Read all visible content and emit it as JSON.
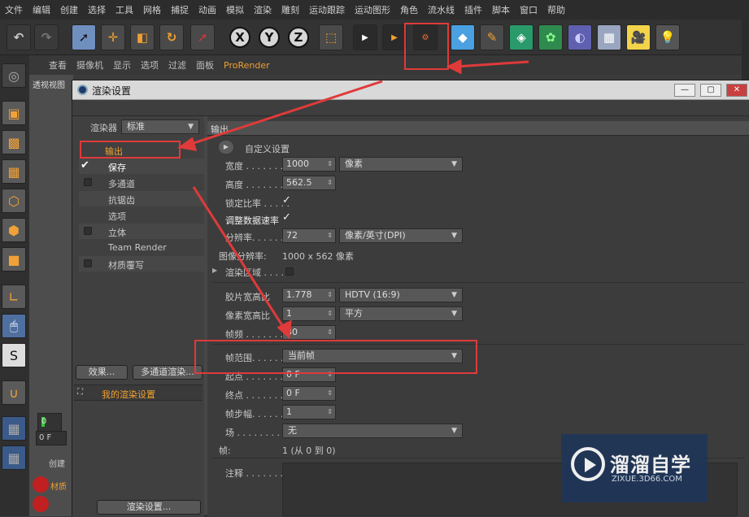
{
  "menubar": {
    "items": [
      "文件",
      "编辑",
      "创建",
      "选择",
      "工具",
      "网格",
      "捕捉",
      "动画",
      "模拟",
      "渲染",
      "雕刻",
      "运动跟踪",
      "运动图形",
      "角色",
      "流水线",
      "插件",
      "脚本",
      "窗口",
      "帮助"
    ]
  },
  "toolbar": {
    "icons": [
      "undo-icon",
      "redo-icon",
      "live-select-icon",
      "move-icon",
      "scale-icon",
      "rotate-icon",
      "recent-tool-icon",
      "x-axis-icon",
      "y-axis-icon",
      "z-axis-icon",
      "coordinate-system-icon",
      "render-view-icon",
      "render-picture-viewer-icon",
      "edit-render-settings-icon",
      "cube-icon",
      "pen-icon",
      "subdivision-icon",
      "cloner-icon",
      "deformer-icon",
      "floor-icon",
      "camera-icon",
      "light-icon"
    ],
    "axis_labels": [
      "X",
      "Y",
      "Z"
    ]
  },
  "viewport_menu": [
    "查看",
    "摄像机",
    "显示",
    "选项",
    "过滤",
    "面板",
    "ProRender"
  ],
  "viewport": {
    "title": "透视视图"
  },
  "dialog": {
    "title": "渲染设置",
    "renderer_label": "渲染器",
    "renderer_value": "标准",
    "section_header": "输出",
    "nav_items": [
      {
        "label": "输出",
        "has_check": false,
        "checked": false
      },
      {
        "label": "保存",
        "has_check": true,
        "checked": true
      },
      {
        "label": "多通道",
        "has_check": true,
        "checked": false
      },
      {
        "label": "抗锯齿",
        "has_check": false,
        "checked": false
      },
      {
        "label": "选项",
        "has_check": false,
        "checked": false
      },
      {
        "label": "立体",
        "has_check": true,
        "checked": false
      },
      {
        "label": "Team Render",
        "has_check": false,
        "checked": false
      },
      {
        "label": "材质覆写",
        "has_check": true,
        "checked": false
      }
    ],
    "effects_button": "效果...",
    "multipass_button": "多通道渲染...",
    "my_render_setting": "我的渲染设置",
    "render_settings_button": "渲染设置...",
    "custom_settings": "自定义设置",
    "width_label": "宽度 . . . . . . . .",
    "width_value": "1000",
    "width_unit": "像素",
    "height_label": "高度 . . . . . . . .",
    "height_value": "562.5",
    "lock_ratio_label": "锁定比率 . . . . .",
    "lock_ratio_check": "✓",
    "adjust_rate_label": "调整数据速率",
    "adjust_rate_check": "✓",
    "resolution_label": "分辨率. . . . . . .",
    "resolution_value": "72",
    "resolution_unit": "像素/英寸(DPI)",
    "image_res_label": "图像分辨率:",
    "image_res_value": "1000 x 562 像素",
    "render_region_label": "渲染区域 . . . .",
    "film_aspect_label": "胶片宽高比",
    "film_aspect_value": "1.778",
    "film_aspect_preset": "HDTV (16:9)",
    "pixel_aspect_label": "像素宽高比",
    "pixel_aspect_value": "1",
    "pixel_aspect_preset": "平方",
    "framerate_label": "帧频 . . . . . . . .",
    "framerate_value": "30",
    "frame_range_label": "帧范围. . . . . .",
    "frame_range_value": "当前帧",
    "start_label": "起点 . . . . . . . .",
    "start_value": "0 F",
    "end_label": "终点 . . . . . . . .",
    "end_value": "0 F",
    "step_label": "帧步幅. . . . . . .",
    "step_value": "1",
    "field_label": "场 . . . . . . . . . .",
    "field_value": "无",
    "frames_label": "帧:",
    "frames_value": "1 (从 0 到 0)",
    "notes_label": "注释 . . . . . . . ."
  },
  "timeline": {
    "frame_value": "0",
    "frame_field": "0 F",
    "create_label": "创建",
    "material_label": "材质"
  },
  "watermark": {
    "title": "溜溜自学",
    "url": "ZIXUE.3D66.COM"
  },
  "colors": {
    "accent_orange": "#f0a030",
    "annotation_red": "#e03a3a"
  }
}
